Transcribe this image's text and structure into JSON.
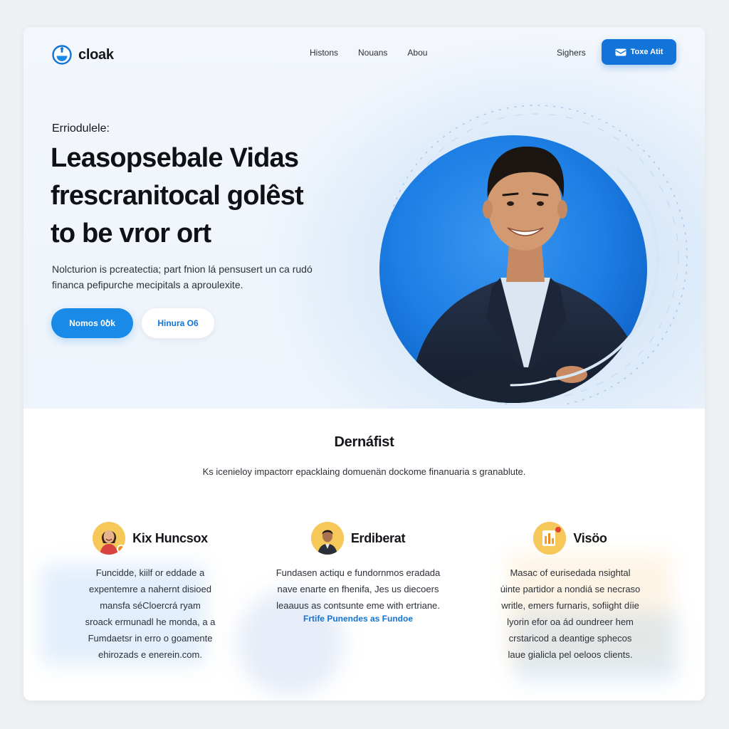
{
  "brand": {
    "name": "cloak"
  },
  "nav": {
    "links": [
      "Histons",
      "Nouans",
      "Abou"
    ],
    "signin": "Sighers",
    "cta": "Toxe Atit"
  },
  "hero": {
    "eyebrow": "Erriodulele:",
    "headline": [
      "Leasopsebale Vidas",
      "frescranitocal golêst",
      "to be vror ort"
    ],
    "lede": [
      "Nolcturion is pcreatectia; part fnion lá pensusert un ca rudó",
      "financa pefipurche mecipitals a aproulexite."
    ],
    "primary_button": "Nomos 0ծk",
    "secondary_button": "Hinura O6"
  },
  "section": {
    "title": "Dernáfist",
    "subtitle": "Ks icenieloy impactorr epacklaing domuenän dockome finanuaria s granablute."
  },
  "features": [
    {
      "title": "Kix Huncsox",
      "body": [
        "Funcidde, kiilf or eddade a",
        "expentemre a nahernt disioed",
        "mansfa séCloercrá ryam",
        "sroack ermunadl he monda, a a",
        "Fumdaetsr in erro o goamente",
        "ehirozads e enerein.com."
      ],
      "link": ""
    },
    {
      "title": "Erdiberat",
      "body": [
        "Fundasen actiqu e fundornmos eradada",
        "nave enarte en fhenifa, Jes us diecoers",
        "leaauus as contsunte eme with ertriane."
      ],
      "link": "Frtife Punendes as Fundoe"
    },
    {
      "title": "Visöo",
      "body": [
        "Masac of eurisedada nsightal",
        "úinte partidor a nondiá se necraso",
        "writle, emers furnaris, sofiight díie",
        "lyorin efor oa ád oundreer hem",
        "crstaricod a deantige sphecos",
        "laue gialicla pel oeloos clients."
      ],
      "link": ""
    }
  ],
  "colors": {
    "accent": "#1273d8",
    "accent_light": "#1a8ae8",
    "portrait_bg": "#1d7ee4"
  }
}
